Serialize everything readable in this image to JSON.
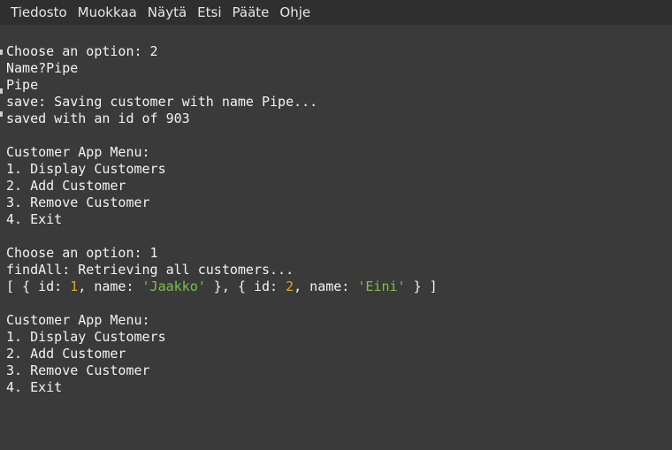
{
  "menubar": {
    "items": [
      "Tiedosto",
      "Muokkaa",
      "Näytä",
      "Etsi",
      "Pääte",
      "Ohje"
    ]
  },
  "terminal": {
    "lines": [
      "Choose an option: 2",
      "Name?Pipe",
      "Pipe",
      "save: Saving customer with name Pipe...",
      "saved with an id of 903",
      "",
      "Customer App Menu:",
      "1. Display Customers",
      "2. Add Customer",
      "3. Remove Customer",
      "4. Exit",
      "",
      "Choose an option: 1",
      "findAll: Retrieving all customers...",
      "",
      "",
      "Customer App Menu:",
      "1. Display Customers",
      "2. Add Customer",
      "3. Remove Customer",
      "4. Exit"
    ],
    "result_line": {
      "p1": "[ { id: ",
      "id1": "1",
      "p2": ", name: ",
      "name1": "'Jaakko'",
      "p3": " }, { id: ",
      "id2": "2",
      "p4": ", name: ",
      "name2": "'Eini'",
      "p5": " } ]"
    },
    "colors": {
      "number": "#d8a82a",
      "string": "#7fbf4d",
      "text": "#f2f2f2",
      "background": "#3a3a3a"
    }
  }
}
